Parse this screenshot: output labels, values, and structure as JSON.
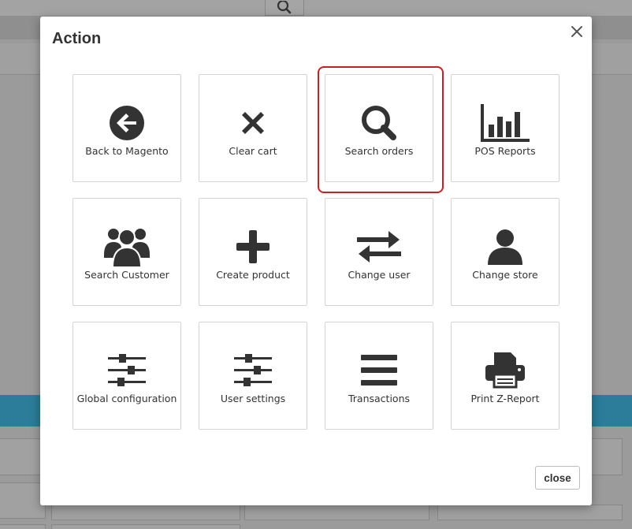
{
  "modal": {
    "title": "Action",
    "close_button_label": "close"
  },
  "actions": [
    {
      "label": "Back to Magento",
      "icon": "arrow-circle-left-icon"
    },
    {
      "label": "Clear cart",
      "icon": "x-icon"
    },
    {
      "label": "Search orders",
      "icon": "search-icon",
      "selected": true
    },
    {
      "label": "POS Reports",
      "icon": "bar-chart-icon"
    },
    {
      "label": "Search Customer",
      "icon": "users-icon"
    },
    {
      "label": "Create product",
      "icon": "plus-icon"
    },
    {
      "label": "Change user",
      "icon": "exchange-icon"
    },
    {
      "label": "Change store",
      "icon": "user-icon"
    },
    {
      "label": "Global configuration",
      "icon": "sliders-icon"
    },
    {
      "label": "User settings",
      "icon": "sliders-icon"
    },
    {
      "label": "Transactions",
      "icon": "bars-icon"
    },
    {
      "label": "Print Z-Report",
      "icon": "printer-icon"
    }
  ],
  "colors": {
    "icon": "#333333",
    "selected_outline": "#cc1f1f",
    "overlay": "#9b9b9b",
    "band": "#2b7d99"
  }
}
